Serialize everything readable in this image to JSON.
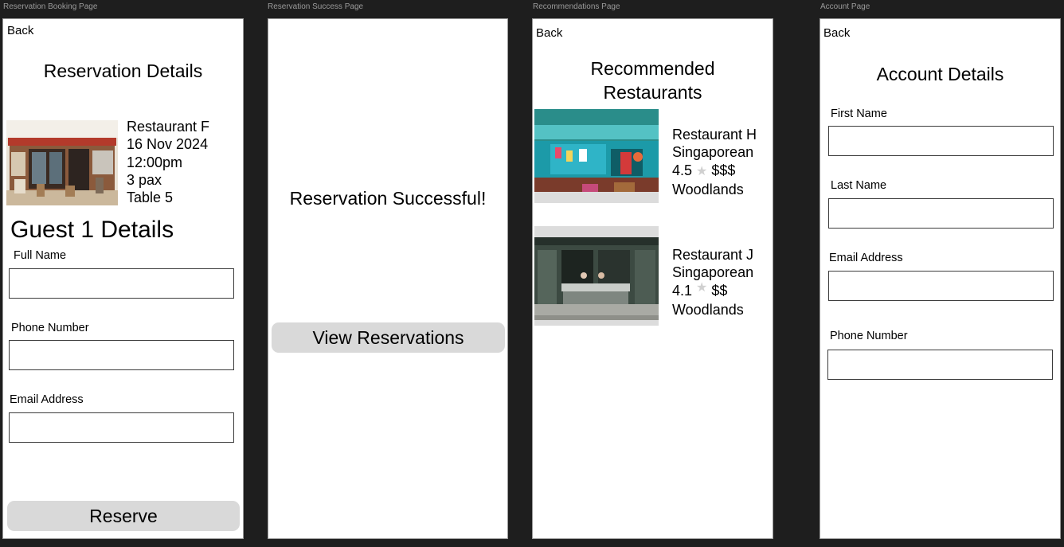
{
  "frames": {
    "booking_label": "Reservation Booking Page",
    "success_label": "Reservation Success Page",
    "recommendations_label": "Recommendations Page",
    "account_label": "Account Page"
  },
  "booking": {
    "back": "Back",
    "title": "Reservation Details",
    "restaurant": "Restaurant F",
    "date": "16 Nov 2024",
    "time": "12:00pm",
    "pax": "3 pax",
    "table": "Table 5",
    "guest_heading": "Guest 1 Details",
    "full_name_label": "Full Name",
    "full_name_value": "",
    "phone_label": "Phone Number",
    "phone_value": "",
    "email_label": "Email Address",
    "email_value": "",
    "reserve_button": "Reserve"
  },
  "success": {
    "message": "Reservation Successful!",
    "view_button": "View Reservations"
  },
  "recommendations": {
    "back": "Back",
    "title_line1": "Recommended",
    "title_line2": "Restaurants",
    "restaurants": [
      {
        "name": "Restaurant H",
        "cuisine": "Singaporean",
        "rating": "4.5",
        "price": "$$$",
        "location": "Woodlands"
      },
      {
        "name": "Restaurant J",
        "cuisine": "Singaporean",
        "rating": "4.1",
        "price": "$$",
        "location": "Woodlands"
      }
    ],
    "star_icon": "star-icon"
  },
  "account": {
    "back": "Back",
    "title": "Account Details",
    "first_name_label": "First Name",
    "first_name_value": "",
    "last_name_label": "Last Name",
    "last_name_value": "",
    "email_label": "Email Address",
    "email_value": "",
    "phone_label": "Phone Number",
    "phone_value": ""
  },
  "colors": {
    "canvas": "#1e1e1e",
    "screen": "#ffffff",
    "button": "#d9d9d9",
    "frame_label": "#9a9a9a"
  }
}
